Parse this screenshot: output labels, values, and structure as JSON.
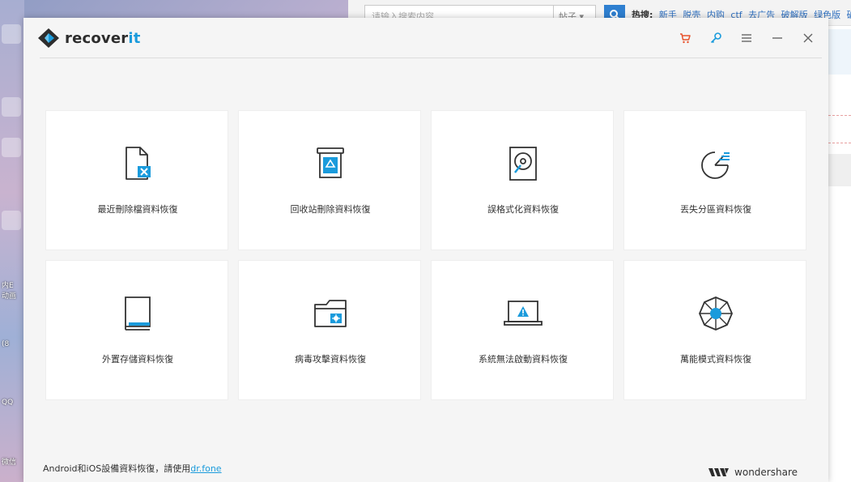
{
  "window": {
    "brand_prefix": "recover",
    "brand_suffix": "it",
    "accent_color": "#1a9bdc",
    "toolbar_icons": [
      "cart-icon",
      "key-icon",
      "menu-icon",
      "minimize-icon",
      "close-icon"
    ]
  },
  "cards": [
    {
      "label": "最近刪除檔資料恢復",
      "icon": "deleted-file-icon"
    },
    {
      "label": "回收站刪除資料恢復",
      "icon": "recycle-bin-icon"
    },
    {
      "label": "誤格式化資料恢復",
      "icon": "formatted-drive-icon"
    },
    {
      "label": "丟失分區資料恢復",
      "icon": "lost-partition-icon"
    },
    {
      "label": "外置存儲資料恢復",
      "icon": "external-storage-icon"
    },
    {
      "label": "病毒攻擊資料恢復",
      "icon": "virus-folder-icon"
    },
    {
      "label": "系統無法啟動資料恢復",
      "icon": "system-crash-icon"
    },
    {
      "label": "萬能模式資料恢復",
      "icon": "all-around-icon"
    }
  ],
  "footer": {
    "note": "Android和iOS設備資料恢復，請使用",
    "link_text": "dr.fone",
    "company": "wondershare"
  },
  "background_browser": {
    "search_placeholder": "请输入搜索内容",
    "search_type": "帖子 ▾",
    "hot_label": "热搜:",
    "hot_links": [
      "新手",
      "脱壳",
      "内购",
      "ctf",
      "去广告",
      "破解版",
      "绿色版",
      "破"
    ]
  },
  "desktop": {
    "labels": [
      "内E",
      "动画",
      "(8",
      "QQ",
      "微信"
    ]
  }
}
